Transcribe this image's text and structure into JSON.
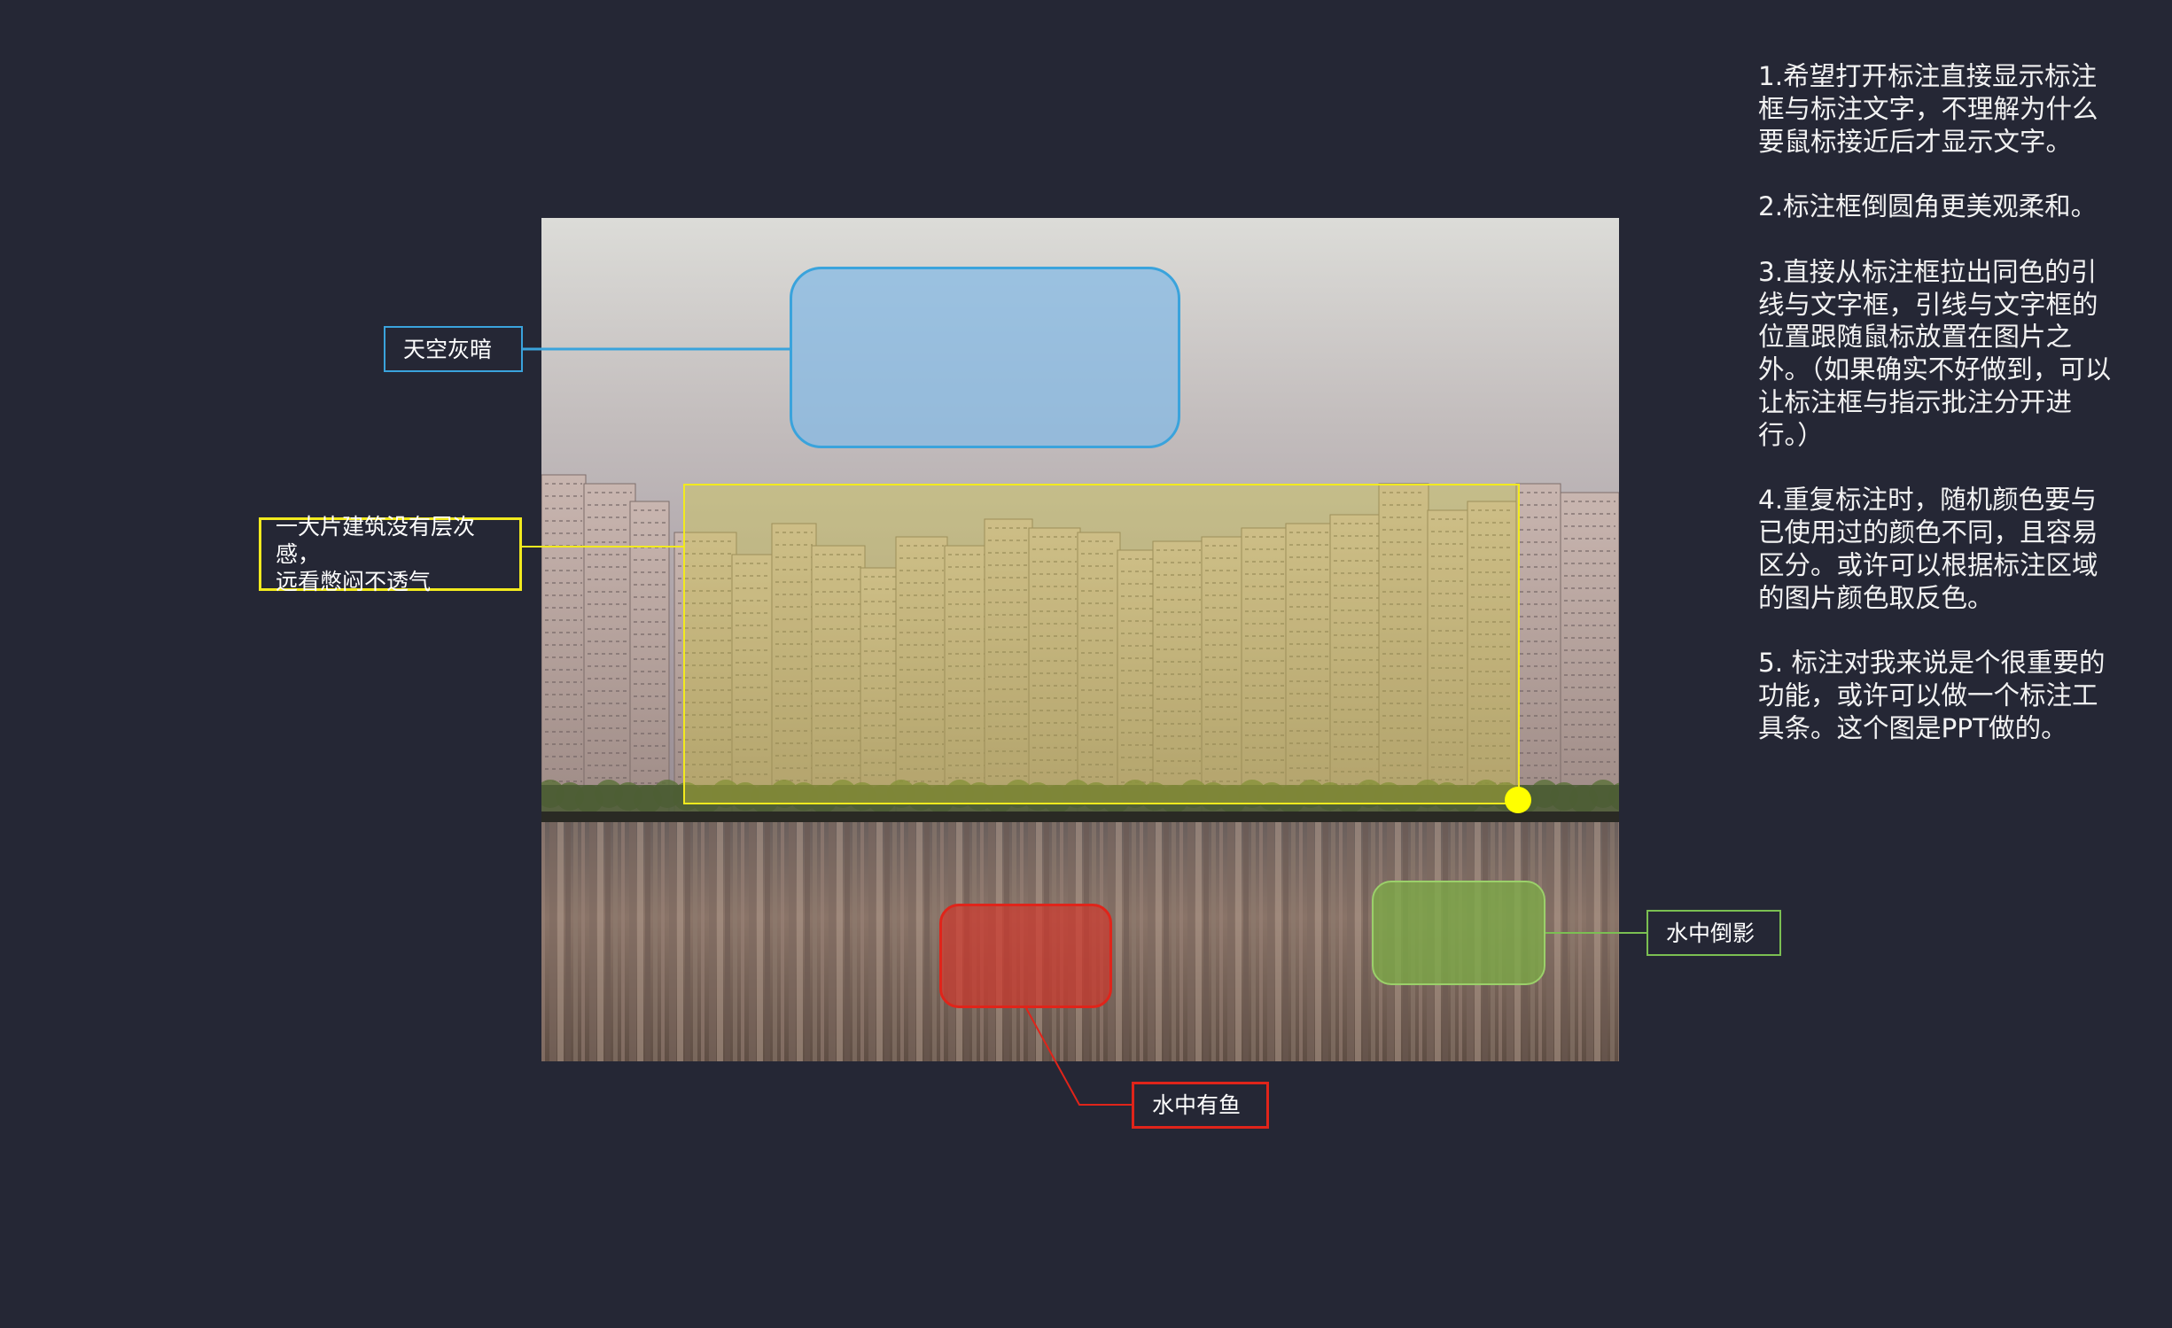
{
  "annotations": {
    "sky": {
      "label": "天空灰暗",
      "color": "#3aa3dc"
    },
    "buildings": {
      "label": "一大片建筑没有层次感，\n远看憋闷不透气",
      "color": "#f2ea1e"
    },
    "reflection": {
      "label": "水中倒影",
      "color": "#7bbf52"
    },
    "fish": {
      "label": "水中有鱼",
      "color": "#e0241a"
    }
  },
  "notes": [
    "1.希望打开标注直接显示标注框与标注文字，不理解为什么要鼠标接近后才显示文字。",
    "2.标注框倒圆角更美观柔和。",
    "3.直接从标注框拉出同色的引线与文字框，引线与文字框的位置跟随鼠标放置在图片之外。（如果确实不好做到，可以让标注框与指示批注分开进行。）",
    "4.重复标注时，随机颜色要与已使用过的颜色不同，且容易区分。或许可以根据标注区域的图片颜色取反色。",
    "5. 标注对我来说是个很重要的功能，或许可以做一个标注工具条。这个图是PPT做的。"
  ],
  "colors": {
    "background": "#252735"
  }
}
